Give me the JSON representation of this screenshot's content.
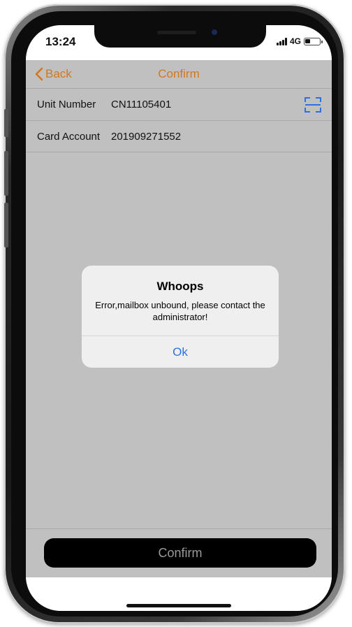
{
  "status_bar": {
    "time": "13:24",
    "network": "4G",
    "battery_level": 0.35
  },
  "nav": {
    "back_label": "Back",
    "title": "Confirm"
  },
  "fields": [
    {
      "label": "Unit Number",
      "value": "CN11105401"
    },
    {
      "label": "Card Account",
      "value": "201909271552"
    }
  ],
  "dialog": {
    "title": "Whoops",
    "message": "Error,mailbox unbound, please contact the administrator!",
    "ok_label": "Ok"
  },
  "footer": {
    "confirm_label": "Confirm"
  },
  "colors": {
    "accent": "#d2781c",
    "link_blue": "#2f6fe0",
    "overlay_gray": "#c0c0c0"
  },
  "icons": {
    "back": "chevron-left-icon",
    "scan": "scan-icon",
    "signal": "signal-icon",
    "battery": "battery-icon"
  }
}
